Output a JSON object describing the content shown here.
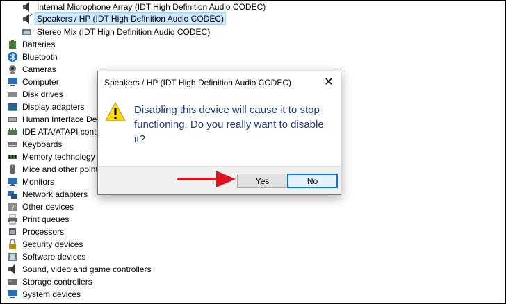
{
  "tree": {
    "items": [
      {
        "label": "Internal Microphone Array (IDT High Definition Audio CODEC)",
        "icon": "speaker-icon"
      },
      {
        "label": "Speakers / HP (IDT High Definition Audio CODEC)",
        "icon": "speaker-icon",
        "selected": true
      },
      {
        "label": "Stereo Mix (IDT High Definition Audio CODEC)",
        "icon": "audio-device-icon"
      },
      {
        "label": "Batteries",
        "icon": "battery-icon"
      },
      {
        "label": "Bluetooth",
        "icon": "bluetooth-icon"
      },
      {
        "label": "Cameras",
        "icon": "camera-icon"
      },
      {
        "label": "Computer",
        "icon": "computer-icon"
      },
      {
        "label": "Disk drives",
        "icon": "disk-drive-icon"
      },
      {
        "label": "Display adapters",
        "icon": "display-adapter-icon"
      },
      {
        "label": "Human Interface Dev",
        "icon": "hid-icon"
      },
      {
        "label": "IDE ATA/ATAPI contro",
        "icon": "ide-controller-icon"
      },
      {
        "label": "Keyboards",
        "icon": "keyboard-icon"
      },
      {
        "label": "Memory technology",
        "icon": "memory-icon"
      },
      {
        "label": "Mice and other point",
        "icon": "mouse-icon"
      },
      {
        "label": "Monitors",
        "icon": "monitor-icon"
      },
      {
        "label": "Network adapters",
        "icon": "network-adapter-icon"
      },
      {
        "label": "Other devices",
        "icon": "other-devices-icon"
      },
      {
        "label": "Print queues",
        "icon": "printer-icon"
      },
      {
        "label": "Processors",
        "icon": "processor-icon"
      },
      {
        "label": "Security devices",
        "icon": "security-device-icon"
      },
      {
        "label": "Software devices",
        "icon": "software-device-icon"
      },
      {
        "label": "Sound, video and game controllers",
        "icon": "sound-controller-icon"
      },
      {
        "label": "Storage controllers",
        "icon": "storage-controller-icon"
      },
      {
        "label": "System devices",
        "icon": "system-device-icon"
      }
    ]
  },
  "dialog": {
    "title": "Speakers / HP (IDT High Definition Audio CODEC)",
    "close_glyph": "✕",
    "message": "Disabling this device will cause it to stop functioning. Do you really want to disable it?",
    "yes_label": "Yes",
    "no_label": "No",
    "icon": "warning-icon"
  },
  "colors": {
    "selection": "#cce8ff",
    "message_text": "#1e3c78",
    "annotation_arrow": "#e0121b",
    "default_button_border": "#0078d7"
  }
}
